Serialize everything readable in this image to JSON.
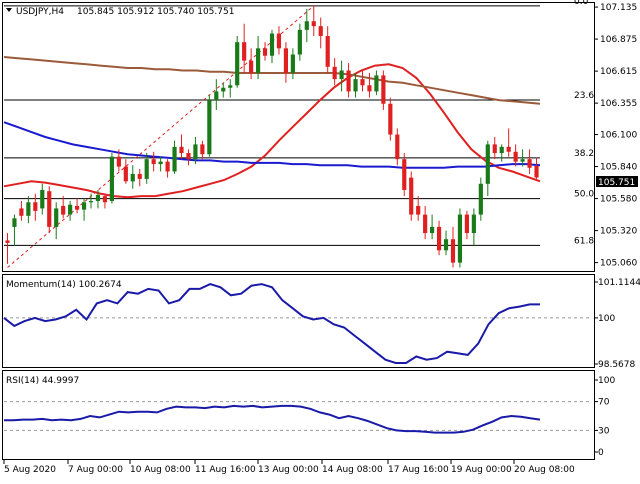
{
  "header": {
    "symbol_timeframe": "USDJPY,H4",
    "ohlc": "105.845 105.912 105.740 105.751"
  },
  "colors": {
    "bull": "#1a7a1a",
    "bear": "#e02020",
    "ma_fast": "#e02020",
    "ma_mid": "#1a1ad0",
    "ma_slow": "#9b5a3a",
    "indicator": "#1a1aa8"
  },
  "fib_levels": [
    {
      "label": "0.0",
      "price": 107.145
    },
    {
      "label": "23.6",
      "price": 106.38
    },
    {
      "label": "38.2",
      "price": 105.91
    },
    {
      "label": "50.0",
      "price": 105.58
    },
    {
      "label": "61.8",
      "price": 105.2
    }
  ],
  "price_axis": {
    "ticks": [
      "107.135",
      "106.875",
      "106.615",
      "106.355",
      "106.100",
      "105.840",
      "105.580",
      "105.320",
      "105.060"
    ],
    "current_price": "105.751"
  },
  "time_axis": {
    "labels": [
      "5 Aug 2020",
      "7 Aug 00:00",
      "10 Aug 08:00",
      "11 Aug 16:00",
      "13 Aug 00:00",
      "14 Aug 08:00",
      "17 Aug 16:00",
      "19 Aug 00:00",
      "20 Aug 08:00"
    ]
  },
  "momentum": {
    "title": "Momentum(14) 100.2674",
    "ticks": [
      "101.1144",
      "100",
      "98.5678"
    ]
  },
  "rsi": {
    "title": "RSI(14) 44.9997",
    "ticks": [
      "100",
      "70",
      "30",
      "0"
    ]
  },
  "chart_data": {
    "type": "candlestick",
    "symbol": "USDJPY",
    "timeframe": "H4",
    "ylim": [
      105.0,
      107.16
    ],
    "candles": [
      {
        "o": 105.24,
        "h": 105.3,
        "l": 105.05,
        "c": 105.22
      },
      {
        "o": 105.35,
        "h": 105.45,
        "l": 105.2,
        "c": 105.42
      },
      {
        "o": 105.5,
        "h": 105.56,
        "l": 105.4,
        "c": 105.44
      },
      {
        "o": 105.44,
        "h": 105.6,
        "l": 105.38,
        "c": 105.55
      },
      {
        "o": 105.55,
        "h": 105.62,
        "l": 105.4,
        "c": 105.48
      },
      {
        "o": 105.5,
        "h": 105.7,
        "l": 105.45,
        "c": 105.65
      },
      {
        "o": 105.64,
        "h": 105.68,
        "l": 105.3,
        "c": 105.35
      },
      {
        "o": 105.35,
        "h": 105.55,
        "l": 105.25,
        "c": 105.5
      },
      {
        "o": 105.52,
        "h": 105.6,
        "l": 105.42,
        "c": 105.45
      },
      {
        "o": 105.45,
        "h": 105.56,
        "l": 105.4,
        "c": 105.53
      },
      {
        "o": 105.52,
        "h": 105.58,
        "l": 105.46,
        "c": 105.49
      },
      {
        "o": 105.49,
        "h": 105.58,
        "l": 105.4,
        "c": 105.55
      },
      {
        "o": 105.55,
        "h": 105.62,
        "l": 105.5,
        "c": 105.56
      },
      {
        "o": 105.56,
        "h": 105.65,
        "l": 105.5,
        "c": 105.61
      },
      {
        "o": 105.6,
        "h": 105.62,
        "l": 105.5,
        "c": 105.55
      },
      {
        "o": 105.56,
        "h": 105.95,
        "l": 105.54,
        "c": 105.92
      },
      {
        "o": 105.92,
        "h": 105.98,
        "l": 105.8,
        "c": 105.84
      },
      {
        "o": 105.84,
        "h": 105.9,
        "l": 105.7,
        "c": 105.72
      },
      {
        "o": 105.72,
        "h": 105.85,
        "l": 105.66,
        "c": 105.78
      },
      {
        "o": 105.78,
        "h": 105.82,
        "l": 105.68,
        "c": 105.74
      },
      {
        "o": 105.74,
        "h": 105.95,
        "l": 105.7,
        "c": 105.9
      },
      {
        "o": 105.9,
        "h": 105.96,
        "l": 105.8,
        "c": 105.86
      },
      {
        "o": 105.86,
        "h": 105.92,
        "l": 105.8,
        "c": 105.88
      },
      {
        "o": 105.88,
        "h": 105.9,
        "l": 105.75,
        "c": 105.8
      },
      {
        "o": 105.8,
        "h": 106.05,
        "l": 105.78,
        "c": 106.0
      },
      {
        "o": 106.0,
        "h": 106.1,
        "l": 105.9,
        "c": 105.95
      },
      {
        "o": 105.95,
        "h": 105.98,
        "l": 105.85,
        "c": 105.9
      },
      {
        "o": 105.9,
        "h": 106.08,
        "l": 105.86,
        "c": 106.02
      },
      {
        "o": 106.02,
        "h": 106.05,
        "l": 105.9,
        "c": 105.94
      },
      {
        "o": 105.94,
        "h": 106.42,
        "l": 105.92,
        "c": 106.38
      },
      {
        "o": 106.38,
        "h": 106.55,
        "l": 106.3,
        "c": 106.45
      },
      {
        "o": 106.45,
        "h": 106.52,
        "l": 106.4,
        "c": 106.48
      },
      {
        "o": 106.48,
        "h": 106.55,
        "l": 106.4,
        "c": 106.5
      },
      {
        "o": 106.5,
        "h": 106.9,
        "l": 106.48,
        "c": 106.85
      },
      {
        "o": 106.85,
        "h": 107.0,
        "l": 106.6,
        "c": 106.7
      },
      {
        "o": 106.7,
        "h": 106.8,
        "l": 106.55,
        "c": 106.6
      },
      {
        "o": 106.6,
        "h": 106.9,
        "l": 106.55,
        "c": 106.8
      },
      {
        "o": 106.8,
        "h": 106.85,
        "l": 106.7,
        "c": 106.74
      },
      {
        "o": 106.74,
        "h": 106.95,
        "l": 106.68,
        "c": 106.92
      },
      {
        "o": 106.92,
        "h": 106.98,
        "l": 106.75,
        "c": 106.8
      },
      {
        "o": 106.8,
        "h": 106.85,
        "l": 106.52,
        "c": 106.6
      },
      {
        "o": 106.6,
        "h": 106.8,
        "l": 106.55,
        "c": 106.75
      },
      {
        "o": 106.75,
        "h": 107.0,
        "l": 106.7,
        "c": 106.95
      },
      {
        "o": 106.95,
        "h": 107.12,
        "l": 106.85,
        "c": 107.02
      },
      {
        "o": 107.02,
        "h": 107.15,
        "l": 106.9,
        "c": 106.98
      },
      {
        "o": 106.98,
        "h": 107.05,
        "l": 106.8,
        "c": 106.9
      },
      {
        "o": 106.9,
        "h": 106.98,
        "l": 106.6,
        "c": 106.65
      },
      {
        "o": 106.65,
        "h": 106.72,
        "l": 106.5,
        "c": 106.55
      },
      {
        "o": 106.55,
        "h": 106.7,
        "l": 106.45,
        "c": 106.62
      },
      {
        "o": 106.62,
        "h": 106.68,
        "l": 106.4,
        "c": 106.45
      },
      {
        "o": 106.45,
        "h": 106.6,
        "l": 106.4,
        "c": 106.55
      },
      {
        "o": 106.55,
        "h": 106.62,
        "l": 106.45,
        "c": 106.5
      },
      {
        "o": 106.5,
        "h": 106.6,
        "l": 106.4,
        "c": 106.45
      },
      {
        "o": 106.45,
        "h": 106.62,
        "l": 106.42,
        "c": 106.58
      },
      {
        "o": 106.58,
        "h": 106.62,
        "l": 106.3,
        "c": 106.35
      },
      {
        "o": 106.35,
        "h": 106.4,
        "l": 106.05,
        "c": 106.1
      },
      {
        "o": 106.1,
        "h": 106.15,
        "l": 105.85,
        "c": 105.9
      },
      {
        "o": 105.9,
        "h": 105.95,
        "l": 105.6,
        "c": 105.65
      },
      {
        "o": 105.75,
        "h": 105.8,
        "l": 105.4,
        "c": 105.45
      },
      {
        "o": 105.52,
        "h": 105.6,
        "l": 105.4,
        "c": 105.45
      },
      {
        "o": 105.45,
        "h": 105.52,
        "l": 105.25,
        "c": 105.3
      },
      {
        "o": 105.3,
        "h": 105.45,
        "l": 105.25,
        "c": 105.35
      },
      {
        "o": 105.35,
        "h": 105.4,
        "l": 105.12,
        "c": 105.16
      },
      {
        "o": 105.16,
        "h": 105.32,
        "l": 105.12,
        "c": 105.25
      },
      {
        "o": 105.25,
        "h": 105.35,
        "l": 105.02,
        "c": 105.06
      },
      {
        "o": 105.06,
        "h": 105.5,
        "l": 105.02,
        "c": 105.45
      },
      {
        "o": 105.45,
        "h": 105.48,
        "l": 105.25,
        "c": 105.3
      },
      {
        "o": 105.3,
        "h": 105.5,
        "l": 105.2,
        "c": 105.45
      },
      {
        "o": 105.45,
        "h": 105.75,
        "l": 105.4,
        "c": 105.7
      },
      {
        "o": 105.7,
        "h": 106.05,
        "l": 105.6,
        "c": 106.02
      },
      {
        "o": 106.02,
        "h": 106.08,
        "l": 105.9,
        "c": 105.95
      },
      {
        "o": 105.95,
        "h": 106.02,
        "l": 105.88,
        "c": 106.0
      },
      {
        "o": 106.0,
        "h": 106.15,
        "l": 105.92,
        "c": 105.96
      },
      {
        "o": 105.96,
        "h": 106.02,
        "l": 105.84,
        "c": 105.88
      },
      {
        "o": 105.88,
        "h": 105.98,
        "l": 105.84,
        "c": 105.9
      },
      {
        "o": 105.9,
        "h": 105.98,
        "l": 105.78,
        "c": 105.83
      },
      {
        "o": 105.845,
        "h": 105.912,
        "l": 105.74,
        "c": 105.751
      }
    ],
    "moving_averages": [
      {
        "color_key": "ma_fast",
        "values": [
          105.68,
          105.7,
          105.72,
          105.71,
          105.69,
          105.67,
          105.65,
          105.62,
          105.6,
          105.59,
          105.6,
          105.6,
          105.62,
          105.64,
          105.67,
          105.7,
          105.73,
          105.78,
          105.84,
          105.93,
          106.05,
          106.16,
          106.27,
          106.38,
          106.48,
          106.56,
          106.62,
          106.66,
          106.67,
          106.64,
          106.56,
          106.43,
          106.28,
          106.12,
          105.98,
          105.89,
          105.83,
          105.8,
          105.76,
          105.72
        ]
      },
      {
        "color_key": "ma_mid",
        "values": [
          106.2,
          106.16,
          106.12,
          106.08,
          106.05,
          106.02,
          106.0,
          105.98,
          105.96,
          105.94,
          105.93,
          105.92,
          105.91,
          105.9,
          105.89,
          105.89,
          105.88,
          105.88,
          105.87,
          105.87,
          105.87,
          105.86,
          105.86,
          105.85,
          105.85,
          105.85,
          105.84,
          105.84,
          105.84,
          105.83,
          105.83,
          105.83,
          105.83,
          105.84,
          105.84,
          105.84,
          105.85,
          105.86,
          105.86,
          105.85
        ]
      },
      {
        "color_key": "ma_slow",
        "values": [
          106.73,
          106.72,
          106.71,
          106.7,
          106.69,
          106.68,
          106.67,
          106.66,
          106.65,
          106.64,
          106.64,
          106.63,
          106.63,
          106.62,
          106.62,
          106.61,
          106.61,
          106.6,
          106.6,
          106.6,
          106.6,
          106.6,
          106.6,
          106.6,
          106.6,
          106.59,
          106.57,
          106.55,
          106.53,
          106.52,
          106.5,
          106.48,
          106.46,
          106.44,
          106.42,
          106.4,
          106.38,
          106.37,
          106.36,
          106.35
        ]
      }
    ],
    "momentum_values": [
      100.0,
      99.75,
      99.9,
      100.0,
      99.9,
      99.95,
      100.05,
      100.25,
      99.95,
      100.45,
      100.55,
      100.45,
      100.8,
      100.75,
      100.9,
      100.85,
      100.45,
      100.55,
      100.9,
      100.9,
      101.05,
      100.95,
      100.7,
      100.75,
      101.0,
      101.05,
      100.95,
      100.55,
      100.3,
      100.05,
      99.95,
      100.0,
      99.8,
      99.7,
      99.45,
      99.2,
      98.95,
      98.7,
      98.6,
      98.6,
      98.8,
      98.7,
      98.75,
      98.95,
      98.9,
      98.85,
      99.2,
      99.8,
      100.15,
      100.3,
      100.35,
      100.42,
      100.42
    ],
    "rsi_values": [
      44,
      44,
      45,
      45,
      46,
      44,
      45,
      44,
      46,
      50,
      48,
      52,
      56,
      55,
      56,
      56,
      55,
      60,
      63,
      62,
      62,
      61,
      63,
      62,
      64,
      63,
      64,
      62,
      63,
      64,
      64,
      63,
      60,
      55,
      52,
      47,
      50,
      47,
      43,
      38,
      33,
      30,
      29,
      29,
      28,
      27,
      27,
      27,
      28,
      31,
      37,
      42,
      48,
      50,
      49,
      47,
      45
    ]
  }
}
